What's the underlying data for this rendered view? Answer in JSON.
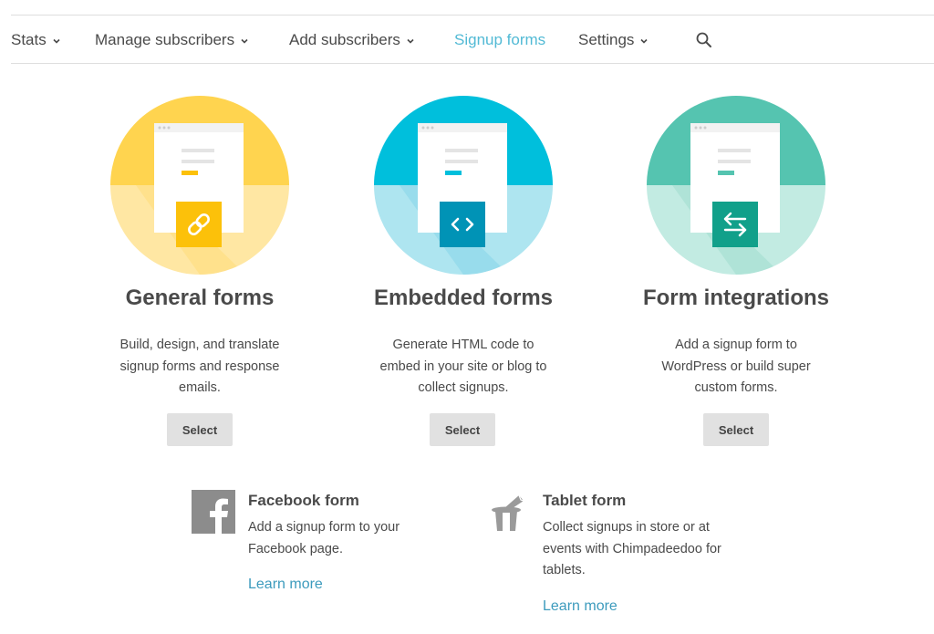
{
  "nav": {
    "items": [
      {
        "label": "Stats",
        "has_dropdown": true,
        "active": false
      },
      {
        "label": "Manage subscribers",
        "has_dropdown": true,
        "active": false
      },
      {
        "label": "Add subscribers",
        "has_dropdown": true,
        "active": false
      },
      {
        "label": "Signup forms",
        "has_dropdown": false,
        "active": true
      },
      {
        "label": "Settings",
        "has_dropdown": true,
        "active": false
      }
    ],
    "search_icon": "search-icon"
  },
  "cards": [
    {
      "title": "General forms",
      "description_lines": [
        "Build, design, and translate",
        "signup forms and response",
        "emails."
      ],
      "button": "Select",
      "icon": "link-icon",
      "colors": {
        "dark": "#ffd44f",
        "light": "#ffe7a3",
        "badge": "#fcc10a"
      }
    },
    {
      "title": "Embedded forms",
      "description_lines": [
        "Generate HTML code to",
        "embed in your site or blog to",
        "collect signups."
      ],
      "button": "Select",
      "icon": "code-icon",
      "colors": {
        "dark": "#00bfdc",
        "light": "#aee5f0",
        "badge": "#0093b6"
      }
    },
    {
      "title": "Form integrations",
      "description_lines": [
        "Add a signup form to",
        "WordPress or build super",
        "custom forms."
      ],
      "button": "Select",
      "icon": "swap-arrows-icon",
      "colors": {
        "dark": "#55c4b0",
        "light": "#c2ebe2",
        "badge": "#11a08a"
      }
    }
  ],
  "extras": [
    {
      "title": "Facebook form",
      "description_lines": [
        "Add a signup form to your",
        "Facebook page."
      ],
      "link": "Learn more",
      "icon": "facebook-icon"
    },
    {
      "title": "Tablet form",
      "description_lines": [
        "Collect signups in store or at",
        "events with Chimpadeedoo for",
        "tablets."
      ],
      "link": "Learn more",
      "icon": "chimpadeedoo-hat-icon"
    }
  ],
  "colors": {
    "accent": "#52bad5",
    "link": "#3d9bbd",
    "button_bg": "#e1e1e1"
  }
}
